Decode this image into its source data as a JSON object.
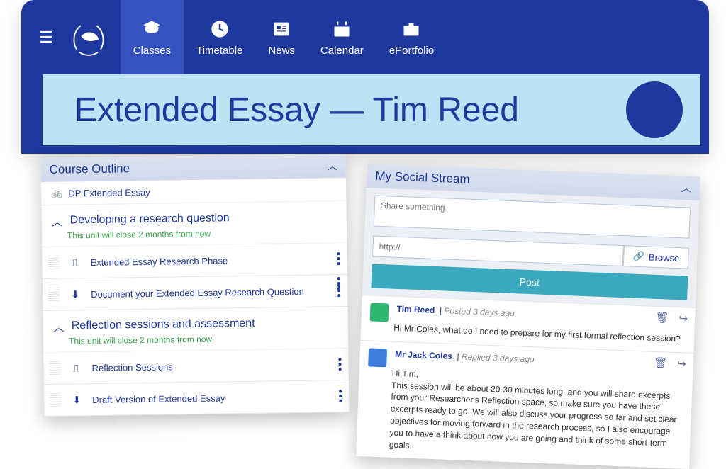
{
  "nav": {
    "items": [
      {
        "label": "Classes",
        "active": true
      },
      {
        "label": "Timetable",
        "active": false
      },
      {
        "label": "News",
        "active": false
      },
      {
        "label": "Calendar",
        "active": false
      },
      {
        "label": "ePortfolio",
        "active": false
      }
    ]
  },
  "banner": {
    "title": "Extended Essay — Tim Reed"
  },
  "outline": {
    "heading": "Course Outline",
    "course": "DP Extended Essay",
    "units": [
      {
        "title": "Developing a research question",
        "sub": "This unit will close 2 months from now",
        "tasks": [
          {
            "icon": "flow",
            "label": "Extended Essay Research Phase"
          },
          {
            "icon": "download",
            "label": "Document your Extended Essay Research Question"
          }
        ]
      },
      {
        "title": "Reflection sessions and assessment",
        "sub": "This unit will close 2 months from now",
        "tasks": [
          {
            "icon": "flow",
            "label": "Reflection Sessions"
          },
          {
            "icon": "download",
            "label": "Draft Version of Extended Essay"
          }
        ]
      }
    ]
  },
  "social": {
    "heading": "My Social Stream",
    "share_placeholder": "Share something",
    "url_placeholder": "http://",
    "browse_label": "Browse",
    "post_label": "Post",
    "posts": [
      {
        "author": "Tim Reed",
        "time": "Posted 3 days ago",
        "body": "Hi Mr Coles, what do I need to prepare for my first formal reflection session?"
      },
      {
        "author": "Mr Jack Coles",
        "time": "Replied 3 days ago",
        "body": "Hi Tim,\nThis session will be about 20-30 minutes long, and you will share excerpts from your Researcher's Reflection space, so make sure you have these excerpts ready to go. We will also discuss your progress so far and set clear objectives for moving forward in the research process, so I also encourage you to have a think about how you are going and think of some short-term goals."
      }
    ]
  }
}
